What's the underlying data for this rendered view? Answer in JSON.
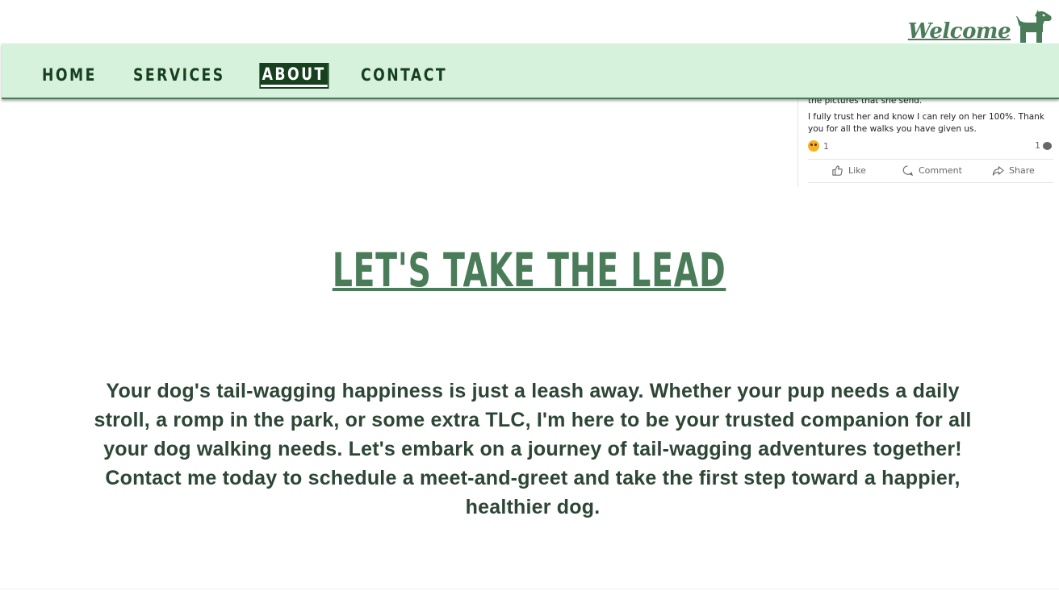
{
  "header": {
    "welcome_text": "Welcome",
    "logo_icon": "dog-icon"
  },
  "nav": {
    "items": [
      {
        "label": "HOME",
        "active": false
      },
      {
        "label": "SERVICES",
        "active": false
      },
      {
        "label": "ABOUT",
        "active": true
      },
      {
        "label": "CONTACT",
        "active": false
      }
    ]
  },
  "review_card": {
    "partial_line": "the pictures that she send.",
    "body": "I fully trust her and know I can rely on her 100%. Thank you for all the walks you have given us.",
    "reaction_count": "1",
    "comment_count": "1",
    "actions": {
      "like": "Like",
      "comment": "Comment",
      "share": "Share"
    }
  },
  "main": {
    "headline": "LET'S TAKE THE LEAD",
    "paragraph": "Your dog's tail-wagging happiness is just a leash away. Whether your pup needs a daily stroll, a romp in the park, or some extra TLC, I'm here to be your trusted companion for all your dog walking needs. Let's embark on a journey of tail-wagging adventures together! Contact me today to schedule a meet-and-greet and take the first step toward a happier, healthier dog."
  },
  "colors": {
    "brand_green": "#4a7c59",
    "dark_green": "#17401f",
    "nav_background": "#d6f1dc",
    "text_green": "#2d4636"
  }
}
